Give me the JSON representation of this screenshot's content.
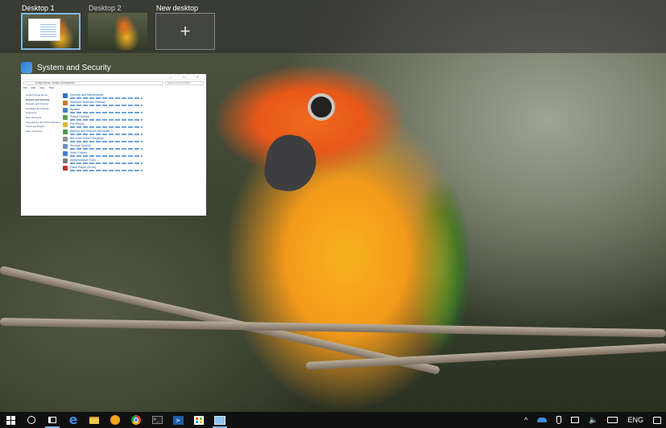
{
  "task_view": {
    "desktops": [
      {
        "label": "Desktop 1",
        "active": true
      },
      {
        "label": "Desktop 2",
        "active": false
      }
    ],
    "new_desktop_label": "New desktop",
    "new_desktop_symbol": "+"
  },
  "window": {
    "title": "System and Security",
    "icon": "control-panel-icon",
    "content": {
      "titlebar_controls": "— ☐ ✕",
      "breadcrumb": "Control Panel  ›  System and Security",
      "search_placeholder": "Search Control Panel",
      "menu": [
        "File",
        "Edit",
        "View",
        "Tools"
      ],
      "sidebar": [
        {
          "label": "Control Panel Home",
          "bold": false
        },
        {
          "label": "System and Security",
          "bold": true
        },
        {
          "label": "Network and Internet",
          "bold": false
        },
        {
          "label": "Hardware and Sound",
          "bold": false
        },
        {
          "label": "Programs",
          "bold": false
        },
        {
          "label": "User Accounts",
          "bold": false
        },
        {
          "label": "Appearance and Personalization",
          "bold": false
        },
        {
          "label": "Clock and Region",
          "bold": false
        },
        {
          "label": "Ease of Access",
          "bold": false
        }
      ],
      "categories": [
        {
          "title": "Security and Maintenance",
          "color": "#2f6fc4"
        },
        {
          "title": "Windows Defender Firewall",
          "color": "#c9772c"
        },
        {
          "title": "System",
          "color": "#3b82c9"
        },
        {
          "title": "Power Options",
          "color": "#5aa050"
        },
        {
          "title": "File History",
          "color": "#e2b53b"
        },
        {
          "title": "Backup and Restore (Windows 7)",
          "color": "#4f9a4f"
        },
        {
          "title": "BitLocker Drive Encryption",
          "color": "#8f8f8f"
        },
        {
          "title": "Storage Spaces",
          "color": "#6a8fbf"
        },
        {
          "title": "Work Folders",
          "color": "#3f7fd0"
        },
        {
          "title": "Administrative Tools",
          "color": "#7a7a7a"
        },
        {
          "title": "Flash Player (32-bit)",
          "color": "#c22f2f"
        }
      ]
    }
  },
  "taskbar": {
    "apps": [
      {
        "name": "start-button",
        "icon": "windows-logo-icon"
      },
      {
        "name": "search-button",
        "icon": "cortana-circle-icon"
      },
      {
        "name": "task-view-button",
        "icon": "task-view-icon",
        "active": true
      },
      {
        "name": "edge-app",
        "icon": "edge-icon"
      },
      {
        "name": "file-explorer-app",
        "icon": "folder-icon"
      },
      {
        "name": "orange-app",
        "icon": "orange-circle-icon"
      },
      {
        "name": "chrome-app",
        "icon": "chrome-icon"
      },
      {
        "name": "command-prompt-app",
        "icon": "command-prompt-icon"
      },
      {
        "name": "powershell-app",
        "icon": "powershell-icon"
      },
      {
        "name": "store-app",
        "icon": "store-icon"
      },
      {
        "name": "control-panel-app",
        "icon": "control-panel-icon",
        "active": true
      }
    ],
    "tray": {
      "chevron": "^",
      "language": "ENG",
      "volume_symbol": "🔈"
    }
  },
  "colors": {
    "active_accent": "#77b3ea",
    "taskbar_bg": "#101010"
  }
}
